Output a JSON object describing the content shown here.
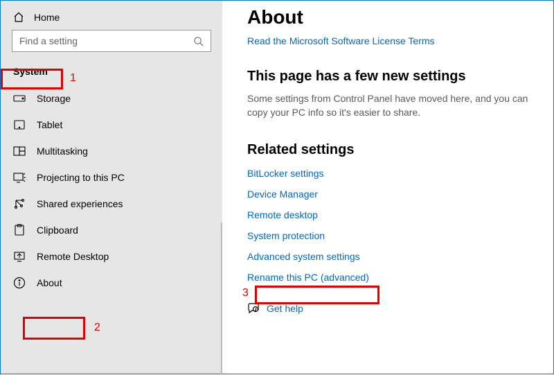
{
  "sidebar": {
    "home_label": "Home",
    "search_placeholder": "Find a setting",
    "section_label": "System",
    "items": [
      {
        "icon": "storage-icon",
        "label": "Storage"
      },
      {
        "icon": "tablet-icon",
        "label": "Tablet"
      },
      {
        "icon": "multitasking-icon",
        "label": "Multitasking"
      },
      {
        "icon": "projecting-icon",
        "label": "Projecting to this PC"
      },
      {
        "icon": "shared-icon",
        "label": "Shared experiences"
      },
      {
        "icon": "clipboard-icon",
        "label": "Clipboard"
      },
      {
        "icon": "remote-icon",
        "label": "Remote Desktop"
      },
      {
        "icon": "about-icon",
        "label": "About"
      }
    ]
  },
  "main": {
    "title": "About",
    "license_link": "Read the Microsoft Software License Terms",
    "new_settings_heading": "This page has a few new settings",
    "new_settings_desc": "Some settings from Control Panel have moved here, and you can copy your PC info so it's easier to share.",
    "related_heading": "Related settings",
    "related_links": [
      "BitLocker settings",
      "Device Manager",
      "Remote desktop",
      "System protection",
      "Advanced system settings",
      "Rename this PC (advanced)"
    ],
    "help_label": "Get help"
  },
  "annotations": {
    "n1": "1",
    "n2": "2",
    "n3": "3"
  }
}
